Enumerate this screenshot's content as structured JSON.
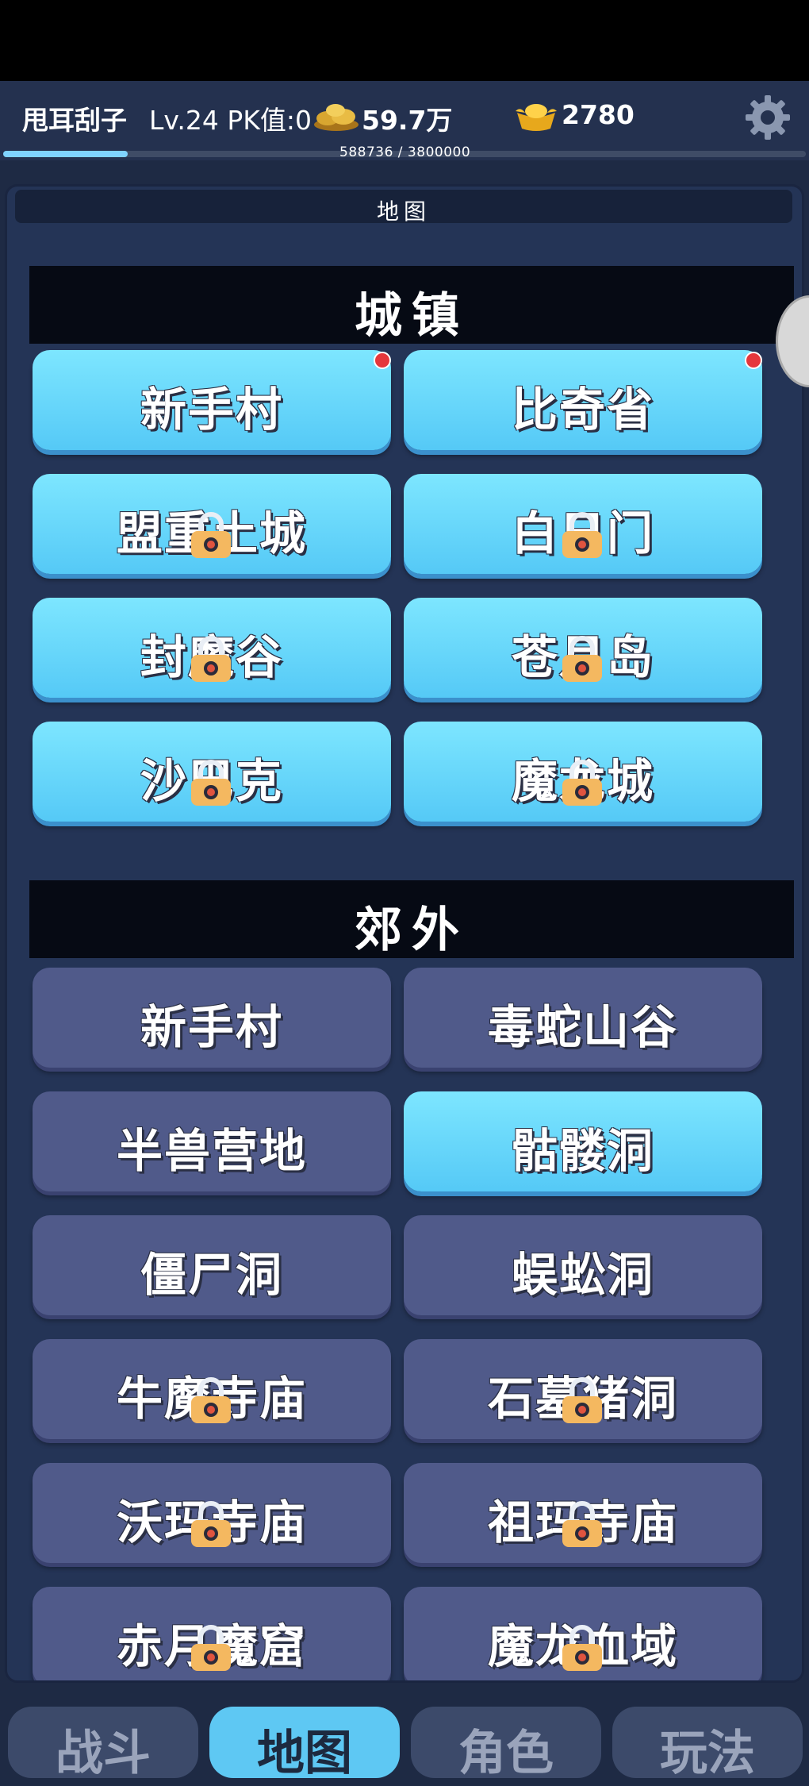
{
  "player": {
    "name": "甩耳刮子",
    "stats": "Lv.24 PK值:0",
    "gold": "59.7万",
    "ingots": "2780",
    "xp": {
      "text": "588736 / 3800000",
      "fraction": 0.155
    }
  },
  "panel": {
    "title": "地图"
  },
  "sections": {
    "towns": {
      "title": "城镇",
      "items": [
        {
          "label": "新手村",
          "locked": false,
          "notify": true
        },
        {
          "label": "比奇省",
          "locked": false,
          "notify": true
        },
        {
          "label": "盟重土城",
          "locked": true
        },
        {
          "label": "白日门",
          "locked": true
        },
        {
          "label": "封魔谷",
          "locked": true
        },
        {
          "label": "苍月岛",
          "locked": true
        },
        {
          "label": "沙巴克",
          "locked": true
        },
        {
          "label": "魔龙城",
          "locked": true
        }
      ]
    },
    "outskirts": {
      "title": "郊外",
      "items": [
        {
          "label": "新手村",
          "locked": false
        },
        {
          "label": "毒蛇山谷",
          "locked": false
        },
        {
          "label": "半兽营地",
          "locked": false
        },
        {
          "label": "骷髅洞",
          "locked": false,
          "highlighted": true
        },
        {
          "label": "僵尸洞",
          "locked": false
        },
        {
          "label": "蜈蚣洞",
          "locked": false
        },
        {
          "label": "牛魔寺庙",
          "locked": true
        },
        {
          "label": "石墓猪洞",
          "locked": true
        },
        {
          "label": "沃玛寺庙",
          "locked": true
        },
        {
          "label": "祖玛寺庙",
          "locked": true
        },
        {
          "label": "赤月魔窟",
          "locked": true
        },
        {
          "label": "魔龙血域",
          "locked": true
        }
      ]
    }
  },
  "nav": {
    "tabs": [
      {
        "label": "战斗",
        "active": false
      },
      {
        "label": "地图",
        "active": true
      },
      {
        "label": "角色",
        "active": false
      },
      {
        "label": "玩法",
        "active": false
      }
    ]
  },
  "colors": {
    "accent": "#5ec8f3",
    "locked_button": "#505a8a",
    "notify": "#e5373b"
  }
}
